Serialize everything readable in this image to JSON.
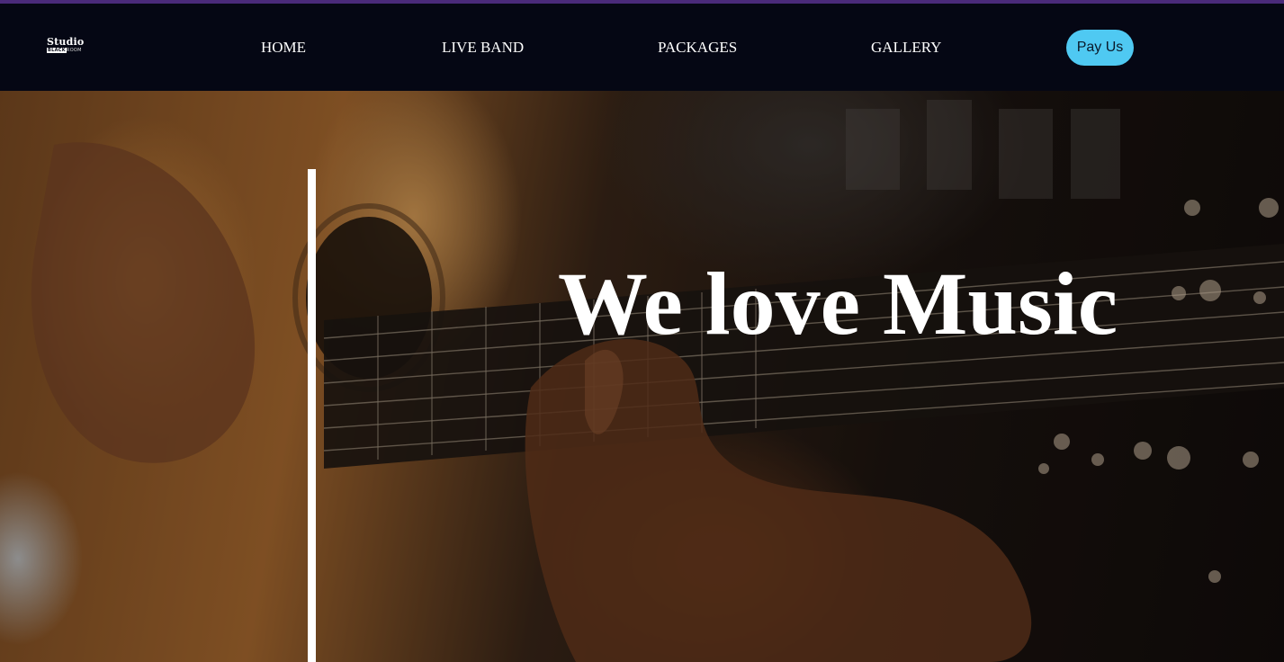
{
  "brand": {
    "name": "Studio",
    "tagline_bold": "BLACK",
    "tagline_rest": "ROOM"
  },
  "nav": {
    "items": [
      {
        "label": "HOME"
      },
      {
        "label": "LIVE BAND"
      },
      {
        "label": "PACKAGES"
      },
      {
        "label": "GALLERY"
      }
    ],
    "cta_label": "Pay Us"
  },
  "hero": {
    "heading": "We love Music",
    "background_image": "guitar-player-photo"
  },
  "colors": {
    "accent_stripe": "#4a2a7a",
    "navbar_bg": "#050714",
    "cta_bg": "#4fc9f2"
  }
}
